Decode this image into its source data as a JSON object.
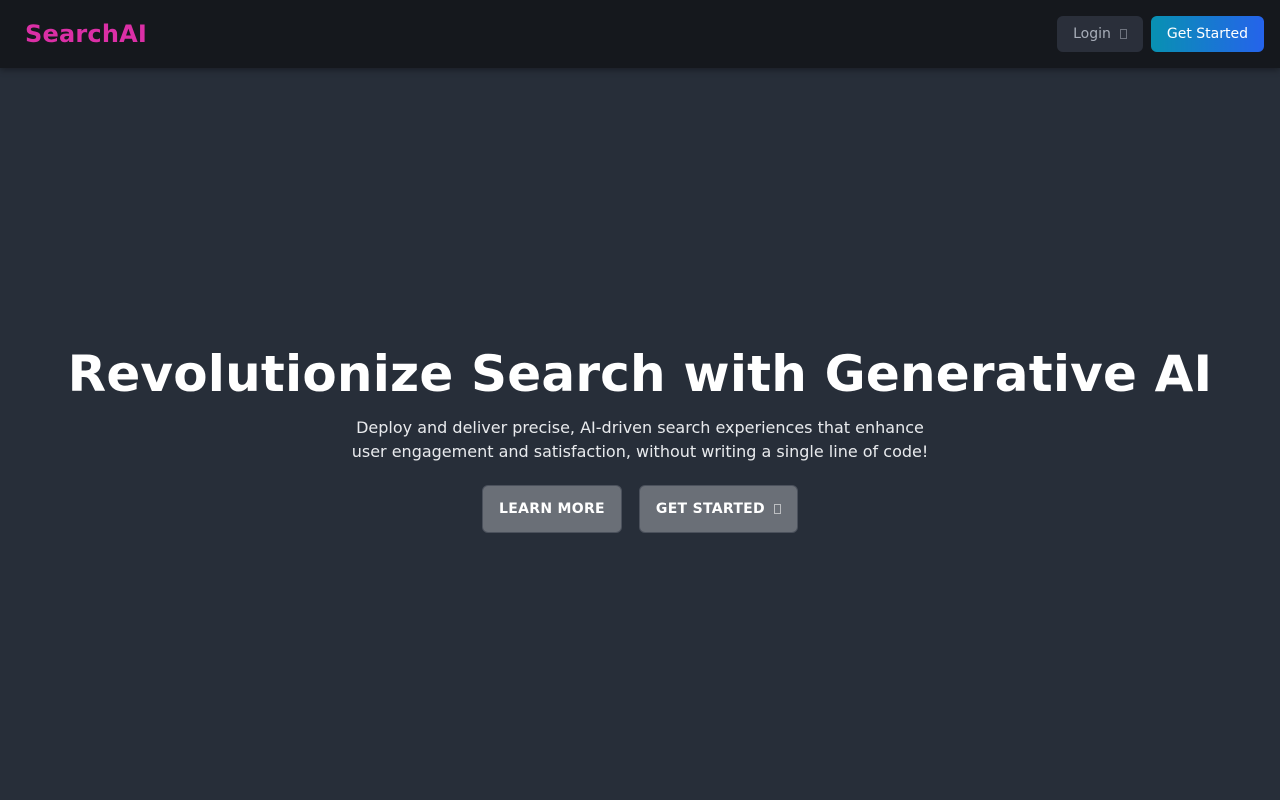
{
  "header": {
    "brand": "SearchAI",
    "login_label": "Login",
    "login_icon": "external-link-icon",
    "get_started_label": "Get Started"
  },
  "hero": {
    "title": "Revolutionize Search with Generative AI",
    "subtitle": "Deploy and deliver precise, AI-driven search experiences that enhance user engagement and satisfaction, without writing a single line of code!",
    "learn_more_label": "LEARN MORE",
    "get_started_label": "GET STARTED",
    "get_started_icon": "arrow-right-icon"
  },
  "colors": {
    "background": "#272e39",
    "navbar": "#15181d",
    "brand": "#db2fa6",
    "cta_gradient_start": "#0891b2",
    "cta_gradient_end": "#2563eb",
    "hero_button": "#6a6f77"
  }
}
